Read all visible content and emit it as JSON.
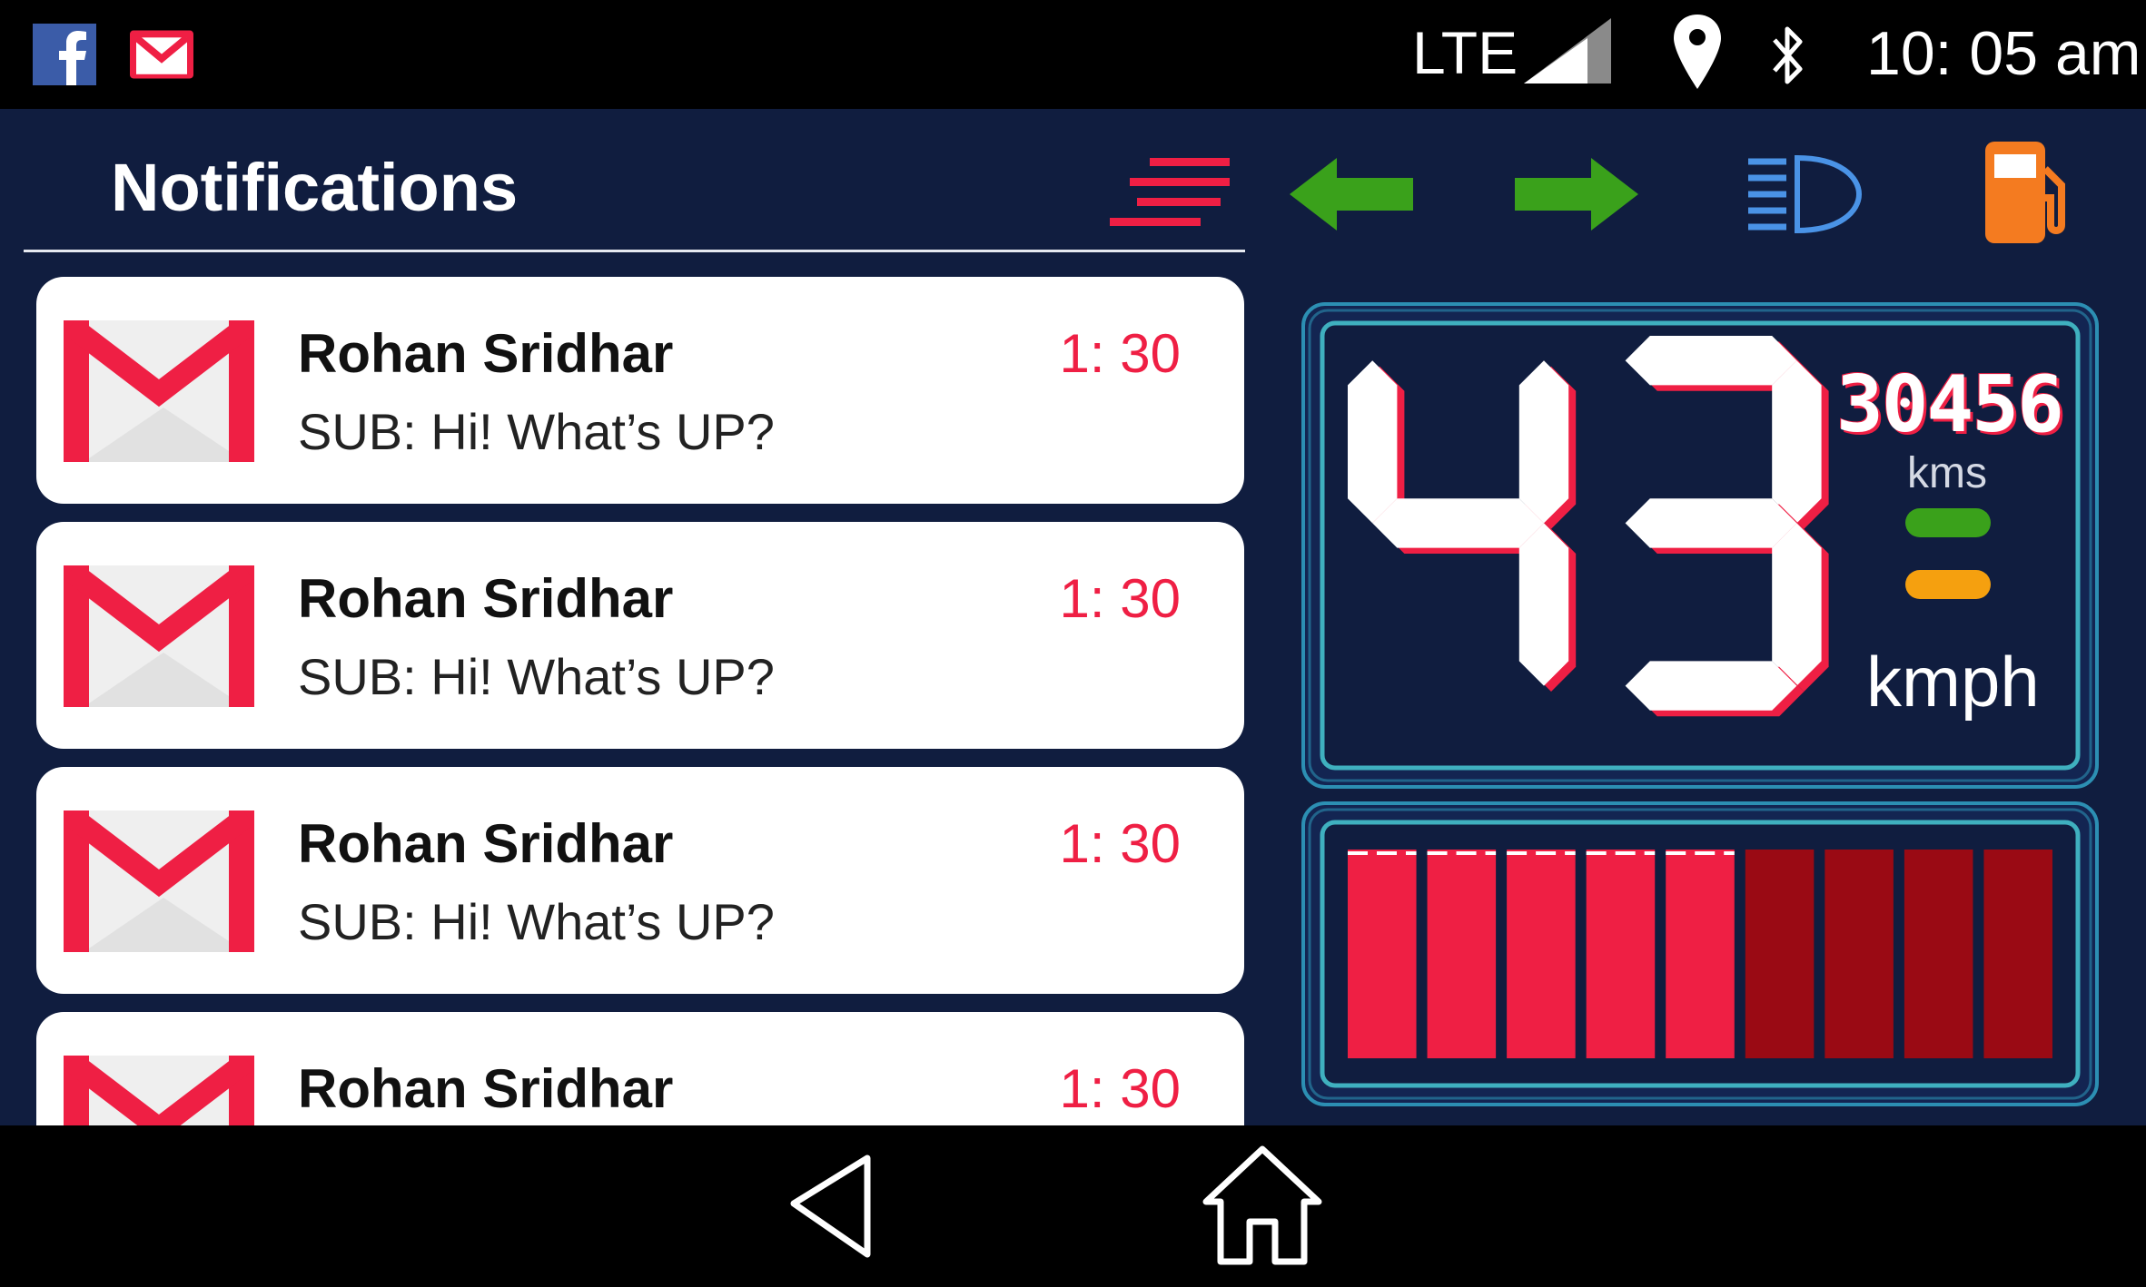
{
  "status_bar": {
    "apps": [
      "facebook-icon",
      "gmail-icon"
    ],
    "network": "LTE",
    "clock": "10: 05 am",
    "icons": [
      "signal-icon",
      "location-pin-icon",
      "bluetooth-icon"
    ]
  },
  "notifications": {
    "title": "Notifications",
    "items": [
      {
        "sender": "Rohan Sridhar",
        "subject": "SUB: Hi! What’s UP?",
        "time": "1: 30",
        "icon": "gmail-icon"
      },
      {
        "sender": "Rohan Sridhar",
        "subject": "SUB: Hi! What’s UP?",
        "time": "1: 30",
        "icon": "gmail-icon"
      },
      {
        "sender": "Rohan Sridhar",
        "subject": "SUB: Hi! What’s UP?",
        "time": "1: 30",
        "icon": "gmail-icon"
      },
      {
        "sender": "Rohan Sridhar",
        "subject": "",
        "time": "1: 30",
        "icon": "gmail-icon"
      }
    ]
  },
  "dashboard": {
    "indicators": [
      "filter-icon",
      "left-turn-arrow-icon",
      "right-turn-arrow-icon",
      "headlight-icon",
      "fuel-pump-icon"
    ],
    "speed": "43",
    "speed_unit": "kmph",
    "odometer": "30456",
    "odometer_unit": "kms",
    "status_lights": [
      "green",
      "orange"
    ],
    "gauge": {
      "total_bars": 9,
      "active_bars": 5
    }
  },
  "colors": {
    "background": "#101d3f",
    "accent_red": "#ef1f44",
    "dim_red": "#9a0a14",
    "green": "#3aa11b",
    "orange": "#f5a00f",
    "headlight_blue": "#4a93e6",
    "fuel_orange": "#f47b20",
    "panel_border": "#2c8fb3"
  },
  "nav_bar": {
    "buttons": [
      "back-button",
      "home-button"
    ]
  }
}
